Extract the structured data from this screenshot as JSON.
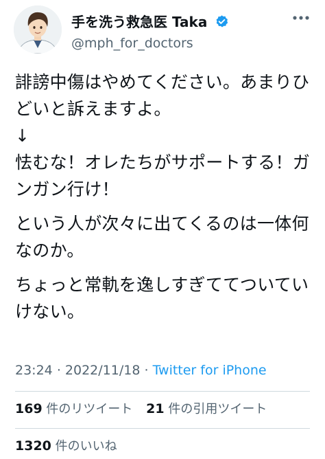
{
  "author": {
    "name": "手を洗う救急医 Taka",
    "handle": "@mph_for_doctors",
    "verified": true,
    "avatar_icon": "doctor-avatar-illustration"
  },
  "tweet": {
    "paragraphs": [
      "誹謗中傷はやめてください。あまりひどいと訴えますよ。",
      "↓",
      "怯むな！オレたちがサポートする！ガンガン行け！",
      "という人が次々に出てくるのは一体何なのか。",
      "ちょっと常軌を逸しすぎててついていけない。"
    ]
  },
  "meta": {
    "time": "23:24",
    "separator": "·",
    "date": "2022/11/18",
    "source": "Twitter for iPhone"
  },
  "stats": {
    "retweets": {
      "count": "169",
      "label": "件のリツイート"
    },
    "quotes": {
      "count": "21",
      "label": "件の引用ツイート"
    },
    "likes": {
      "count": "1320",
      "label": "件のいいね"
    }
  },
  "colors": {
    "accent": "#1d9bf0",
    "text": "#0f1419",
    "secondary": "#536471",
    "divider": "#cfd9de"
  }
}
